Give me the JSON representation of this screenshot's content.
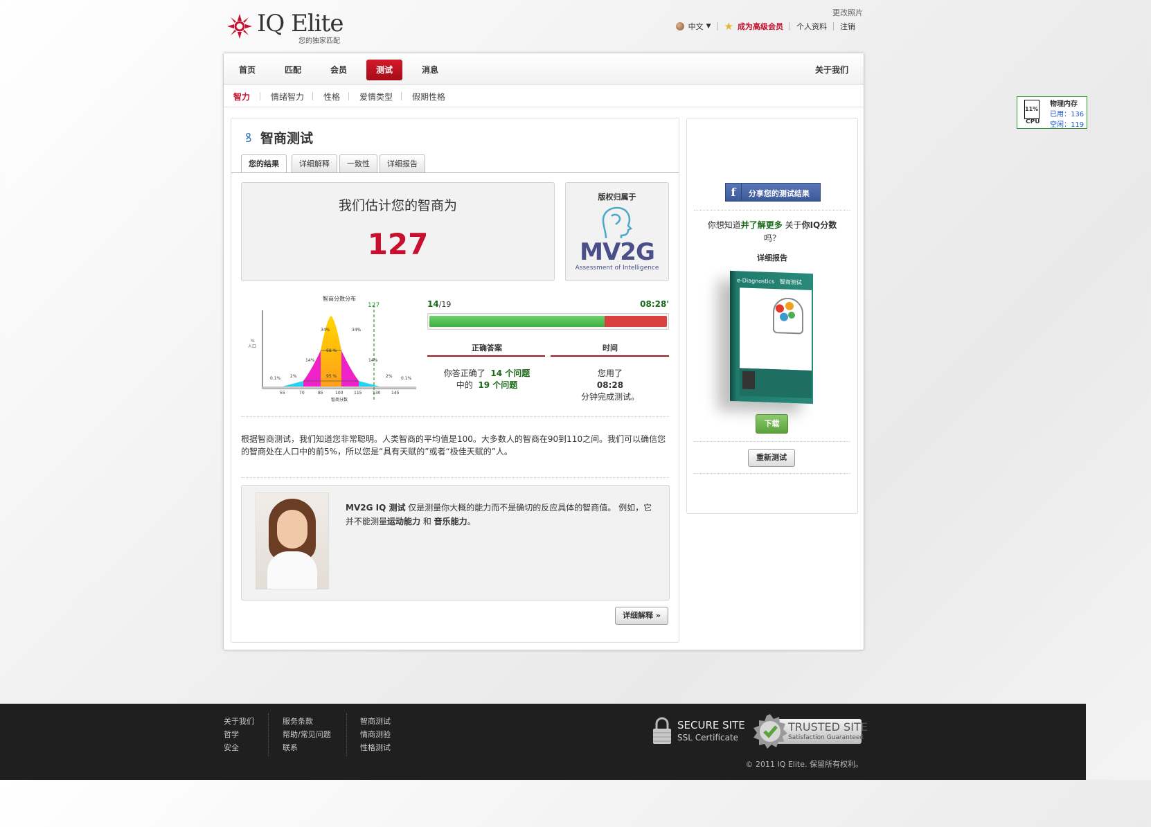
{
  "header": {
    "logo_text": "IQ Elite",
    "logo_sub": "您的独家匹配",
    "change_photo": "更改照片",
    "language": "中文",
    "premium": "成为高级会员",
    "profile": "个人资料",
    "logout": "注销"
  },
  "nav": {
    "items": [
      "首页",
      "匹配",
      "会员",
      "测试",
      "消息"
    ],
    "active": "测试",
    "about": "关于我们"
  },
  "subnav": {
    "items": [
      "智力",
      "情绪智力",
      "性格",
      "爱情类型",
      "假期性格"
    ],
    "active": "智力"
  },
  "page_title": "智商测试",
  "tabs": [
    "您的结果",
    "详细解释",
    "一致性",
    "详细报告"
  ],
  "result": {
    "estimate_label": "我们估计您的智商为",
    "iq": "127"
  },
  "copyright": {
    "label": "版权归属于",
    "brand": "MV2G",
    "brand_sub": "Assessment of Intelligence"
  },
  "distribution": {
    "title": "智商分数分布",
    "marker": "127",
    "ylabel_top": "%",
    "ylabel": "人口",
    "xlabel": "智商分数",
    "ticks": [
      "55",
      "70",
      "85",
      "100",
      "115",
      "130",
      "145"
    ],
    "pct": [
      "0.1%",
      "2%",
      "14%",
      "34%",
      "34%",
      "14%",
      "2%",
      "0.1%"
    ],
    "band68": "68 %",
    "band95": "95 %"
  },
  "stats": {
    "score": "14",
    "total": "/19",
    "time": "08:28'",
    "progress_fraction": 0.737,
    "correct_header": "正确答案",
    "time_header": "时间",
    "correct_line1_a": "你答正确了",
    "correct_line1_b": "14 个问题",
    "correct_line2_a": "中的",
    "correct_line2_b": "19 个问题",
    "time_line1": "您用了",
    "time_value": "08:28",
    "time_line3": "分钟完成测试。"
  },
  "explanation": "根据智商测试，我们知道您非常聪明。人类智商的平均值是100。大多数人的智商在90到110之间。我们可以确信您的智商处在人口中的前5%，所以您是“具有天赋的”或者“极佳天赋的”人。",
  "note": {
    "bold1": "MV2G IQ 测试",
    "text1": " 仅是测量你大概的能力而不是确切的反应具体的智商值。 例如，它并不能测量",
    "bold2": "运动能力",
    "text2": " 和 ",
    "bold3": "音乐能力",
    "text3": "。"
  },
  "more_button": "详细解释 »",
  "sidebar": {
    "share": "分享您的测试结果",
    "q_a": "你想知道",
    "q_b": "并了解更多",
    "q_c": " 关于",
    "q_d": "你IQ分数",
    "q_e": "吗？",
    "report_title": "详细报告",
    "book_brand": "e-Diagnostics",
    "book_title": "智商测试",
    "download": "下载",
    "retest": "重新测试"
  },
  "footer": {
    "col1": [
      "关于我们",
      "哲学",
      "安全"
    ],
    "col2": [
      "服务条款",
      "帮助/常见问题",
      "联系"
    ],
    "col3": [
      "智商测试",
      "情商测验",
      "性格测试"
    ],
    "secure_title": "SECURE SITE",
    "secure_sub": "SSL Certificate",
    "trusted_title": "TRUSTED SITE",
    "trusted_sub": "Satisfaction Guaranteed",
    "copyright": "© 2011 IQ Elite. 保留所有权利。"
  },
  "monitor": {
    "cpu_pct": "11%",
    "cpu": "CPU",
    "mem_title": "物理内存",
    "used": "已用：136",
    "free": "空闲：119"
  },
  "colors": {
    "accent_red": "#c8102e",
    "green": "#1a7a1a",
    "bar_green": "#4cbf4c",
    "bar_red": "#d94040"
  }
}
